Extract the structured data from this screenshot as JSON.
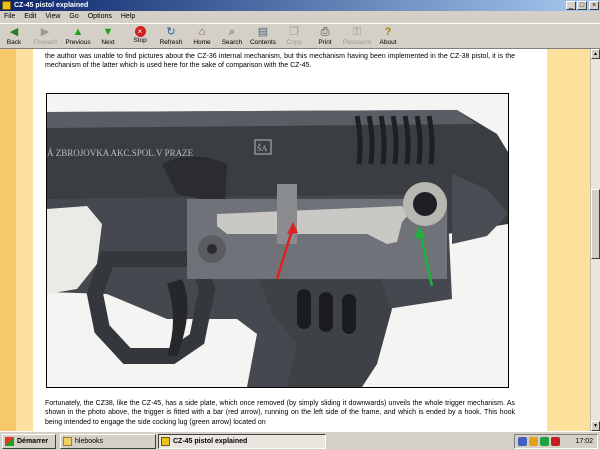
{
  "window": {
    "title": "CZ-45 pistol explained",
    "controls": {
      "minimize": "_",
      "maximize": "□",
      "close": "×"
    }
  },
  "menu": [
    "File",
    "Edit",
    "View",
    "Go",
    "Options",
    "Help"
  ],
  "toolbar": {
    "back": "Back",
    "forward": "Forward",
    "previous": "Previous",
    "next": "Next",
    "stop": "Stop",
    "refresh": "Refresh",
    "home": "Home",
    "search": "Search",
    "contents": "Contents",
    "copy": "Copy",
    "print": "Print",
    "password": "Password",
    "about": "About"
  },
  "content": {
    "para1": "the author was unable to find pictures about the CZ-36 internal mechanism, but this mechanism having been implemented in the CZ-38 pistol, it is the mechanism of the latter which is used here for the sake of comparison with the CZ-45.",
    "photo_inscription": "Á ZBROJOVKA AKC.SPOL.V PRAZE",
    "photo_logo": "ŠA",
    "para2": "Fortunately, the CZ38, like the CZ-45, has a side plate, which once removed (by simply sliding it downwards) unveils the whole trigger mechanism. As shown in the photo above, the trigger is fitted with a bar (red arrow), running on the left side of the frame, and which is ended by a hook. This hook being intended to engage the side cocking lug (green arrow) located on",
    "colors": {
      "red_arrow": "#e02020",
      "green_arrow": "#20b040"
    }
  },
  "taskbar": {
    "start": "Démarrer",
    "tasks": [
      "hlebooks",
      "CZ-45 pistol explained"
    ],
    "clock": "17:02"
  }
}
